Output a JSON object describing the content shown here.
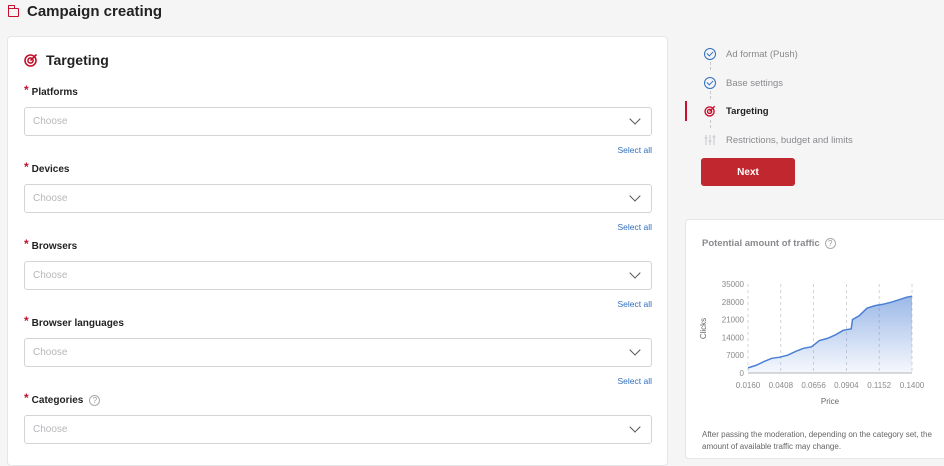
{
  "header": {
    "title": "Campaign creating",
    "icon": "folder-icon"
  },
  "targeting": {
    "title": "Targeting",
    "fields": [
      {
        "label": "Platforms",
        "placeholder": "Choose",
        "action": "Select all"
      },
      {
        "label": "Devices",
        "placeholder": "Choose",
        "action": "Select all"
      },
      {
        "label": "Browsers",
        "placeholder": "Choose",
        "action": "Select all"
      },
      {
        "label": "Browser languages",
        "placeholder": "Choose",
        "action": "Select all"
      },
      {
        "label": "Categories",
        "placeholder": "Choose",
        "help": "?"
      }
    ]
  },
  "steps": [
    {
      "label": "Ad format (Push)",
      "state": "done"
    },
    {
      "label": "Base settings",
      "state": "done"
    },
    {
      "label": "Targeting",
      "state": "active"
    },
    {
      "label": "Restrictions, budget and limits",
      "state": "pending"
    }
  ],
  "next_button": "Next",
  "traffic": {
    "title": "Potential amount of traffic",
    "help": "?",
    "note": "After passing the moderation, depending on the category set, the amount of available traffic may change."
  },
  "colors": {
    "accent": "#c0272f",
    "link": "#2f6fbf",
    "chart": "#4a7fd4"
  },
  "chart_data": {
    "type": "area",
    "xlabel": "Price",
    "ylabel": "Clicks",
    "x_ticks": [
      "0.0160",
      "0.0408",
      "0.0656",
      "0.0904",
      "0.1152",
      "0.1400"
    ],
    "y_ticks": [
      "35000",
      "28000",
      "21000",
      "14000",
      "7000",
      "0"
    ],
    "xlim": [
      0.016,
      0.14
    ],
    "ylim": [
      0,
      35000
    ],
    "x": [
      0.016,
      0.022,
      0.028,
      0.034,
      0.04,
      0.046,
      0.052,
      0.058,
      0.064,
      0.07,
      0.076,
      0.082,
      0.088,
      0.094,
      0.095,
      0.1,
      0.106,
      0.112,
      0.118,
      0.124,
      0.13,
      0.136,
      0.14
    ],
    "values": [
      2000,
      3000,
      4500,
      5800,
      6200,
      7000,
      8500,
      9700,
      10300,
      12800,
      13600,
      15000,
      16800,
      17400,
      21000,
      22500,
      25500,
      26500,
      27000,
      27800,
      28800,
      29800,
      30200
    ]
  }
}
